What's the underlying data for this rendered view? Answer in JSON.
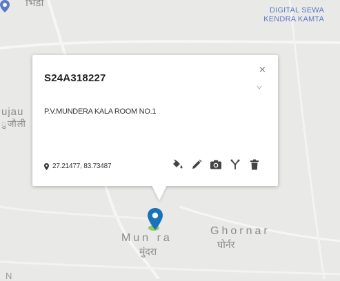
{
  "map": {
    "labels": {
      "bhinda": "भिंडा",
      "gujauli_latin": "ujau",
      "gujauli_hindi": "ुजौली",
      "mundera_latin": "Mun   ra",
      "mundera_hindi": "मुंदरा",
      "ghornar_latin": "Ghornar",
      "ghornar_hindi": "घोर्नर",
      "bottom_partial": "N         "
    },
    "poi": {
      "name_line1": "DIGITAL SEWA",
      "name_line2": "KENDRA KAMTA",
      "icon": "map-pin-icon"
    },
    "marker": {
      "icon": "map-marker-icon",
      "color": "#1a73b8"
    }
  },
  "popup": {
    "title": "S24A318227",
    "close_label": "×",
    "address": "P.V.MUNDERA KALA ROOM NO.1",
    "coordinates": "27.21477, 83.73487",
    "tools": [
      {
        "name": "paint-bucket-icon",
        "label": "Style"
      },
      {
        "name": "pencil-icon",
        "label": "Edit"
      },
      {
        "name": "camera-icon",
        "label": "Photo"
      },
      {
        "name": "branch-icon",
        "label": "Connect"
      },
      {
        "name": "trash-icon",
        "label": "Delete"
      }
    ]
  },
  "colors": {
    "poi": "#5b78c9",
    "marker": "#1a73b8",
    "map_bg": "#e9e9e7",
    "road": "#ffffff"
  }
}
